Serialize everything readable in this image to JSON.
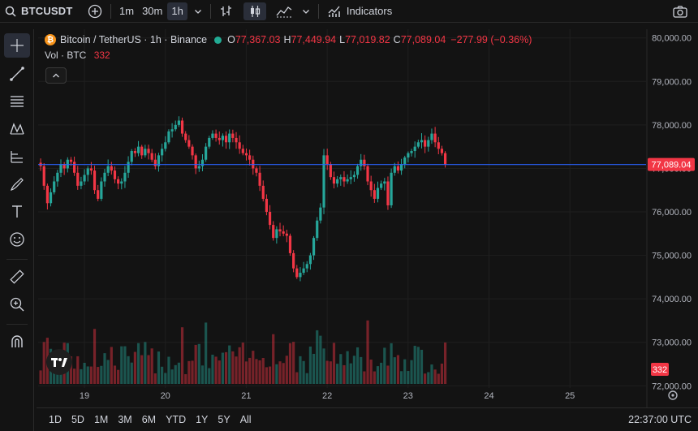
{
  "toolbar": {
    "symbol": "BTCUSDT",
    "intervals": [
      "1m",
      "30m",
      "1h"
    ],
    "active_interval": "1h",
    "indicators_label": "Indicators"
  },
  "legend": {
    "name": "Bitcoin / TetherUS · 1h · Binance",
    "logo": "₿",
    "open_key": "O",
    "open": "77,367.03",
    "high_key": "H",
    "high": "77,449.94",
    "low_key": "L",
    "low": "77,019.82",
    "close_key": "C",
    "close": "77,089.04",
    "change": "−277.99 (−0.36%)",
    "vol_label": "Vol · BTC",
    "vol_value": "332"
  },
  "bottom": {
    "ranges": [
      "1D",
      "5D",
      "1M",
      "3M",
      "6M",
      "YTD",
      "1Y",
      "5Y",
      "All"
    ],
    "clock": "22:37:00 UTC"
  },
  "colors": {
    "up": "#26a69a",
    "down": "#f23645",
    "price_line": "#2962ff",
    "bg": "#131313",
    "grid": "#1f1f1f"
  },
  "chart_data": {
    "type": "candlestick",
    "x_ticks": [
      "19",
      "20",
      "21",
      "22",
      "23",
      "24",
      "25"
    ],
    "y_ticks": [
      "80,000.00",
      "79,000.00",
      "78,000.00",
      "77,000.00",
      "76,000.00",
      "75,000.00",
      "74,000.00",
      "73,000.00",
      "72,000.00"
    ],
    "y_tick_values": [
      80000,
      79000,
      78000,
      77000,
      76000,
      75000,
      74000,
      73000,
      72000
    ],
    "ylim": [
      71950,
      80200
    ],
    "last_price_label": "77,089.04",
    "last_price": 77089.04,
    "volume_label": "332",
    "hourly_closes": [
      77050,
      76600,
      76200,
      76450,
      76700,
      76900,
      77100,
      77000,
      77200,
      77150,
      76900,
      76600,
      76700,
      76850,
      77000,
      76950,
      76500,
      76300,
      76700,
      76900,
      77050,
      76950,
      76750,
      76650,
      76700,
      76900,
      77150,
      77400,
      77350,
      77500,
      77300,
      77450,
      77350,
      77200,
      77050,
      77300,
      77450,
      77600,
      77850,
      77900,
      78000,
      78100,
      77800,
      77650,
      77500,
      77300,
      77000,
      77050,
      77200,
      77500,
      77700,
      77800,
      77700,
      77650,
      77750,
      77600,
      77800,
      77700,
      77600,
      77450,
      77350,
      77300,
      77200,
      77000,
      76900,
      76600,
      76300,
      76000,
      75700,
      75400,
      75600,
      75550,
      75500,
      75450,
      75050,
      74700,
      74500,
      74600,
      74700,
      74800,
      75000,
      75400,
      75800,
      76100,
      77300,
      77100,
      76800,
      76650,
      76750,
      76800,
      76700,
      76750,
      76800,
      76850,
      77050,
      77200,
      77050,
      76700,
      76500,
      76300,
      76550,
      76650,
      76700,
      76150,
      76900,
      77050,
      76950,
      77100,
      77250,
      77350,
      77400,
      77500,
      77600,
      77650,
      77500,
      77650,
      77800,
      77600,
      77450,
      77350,
      77089
    ]
  }
}
